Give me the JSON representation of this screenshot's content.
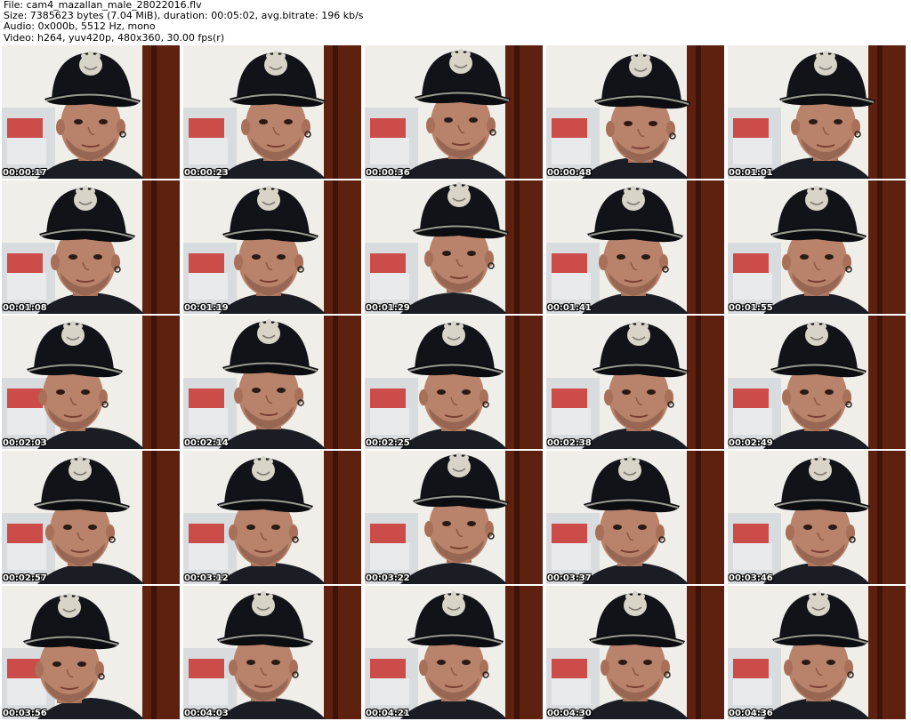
{
  "header": {
    "file_line": "File: cam4_mazallan_male_28022016.flv",
    "size_line": "Size: 7385623 bytes (7.04 MiB), duration: 00:05:02, avg.bitrate: 196 kb/s",
    "audio_line": "Audio: 0x000b, 5512 Hz, mono",
    "video_line": "Video: h264, yuv420p, 480x360, 30.00 fps(r)"
  },
  "thumbnails": [
    {
      "timestamp": "00:00:17"
    },
    {
      "timestamp": "00:00:23"
    },
    {
      "timestamp": "00:00:36"
    },
    {
      "timestamp": "00:00:48"
    },
    {
      "timestamp": "00:01:01"
    },
    {
      "timestamp": "00:01:08"
    },
    {
      "timestamp": "00:01:19"
    },
    {
      "timestamp": "00:01:29"
    },
    {
      "timestamp": "00:01:41"
    },
    {
      "timestamp": "00:01:55"
    },
    {
      "timestamp": "00:02:03"
    },
    {
      "timestamp": "00:02:14"
    },
    {
      "timestamp": "00:02:25"
    },
    {
      "timestamp": "00:02:38"
    },
    {
      "timestamp": "00:02:49"
    },
    {
      "timestamp": "00:02:57"
    },
    {
      "timestamp": "00:03:12"
    },
    {
      "timestamp": "00:03:22"
    },
    {
      "timestamp": "00:03:37"
    },
    {
      "timestamp": "00:03:46"
    },
    {
      "timestamp": "00:03:56"
    },
    {
      "timestamp": "00:04:03"
    },
    {
      "timestamp": "00:04:21"
    },
    {
      "timestamp": "00:04:30"
    },
    {
      "timestamp": "00:04:36"
    }
  ],
  "colors": {
    "background": "#ffffff",
    "header_text": "#000000",
    "timestamp_text": "#ffffff",
    "cap": "#111318",
    "cap_logo": "#d8d4c8",
    "skin": "#b9826a",
    "wall": "#f0efe9",
    "door": "#5e2110",
    "shirt": "#1b1d24",
    "red_object": "#c8322e"
  }
}
